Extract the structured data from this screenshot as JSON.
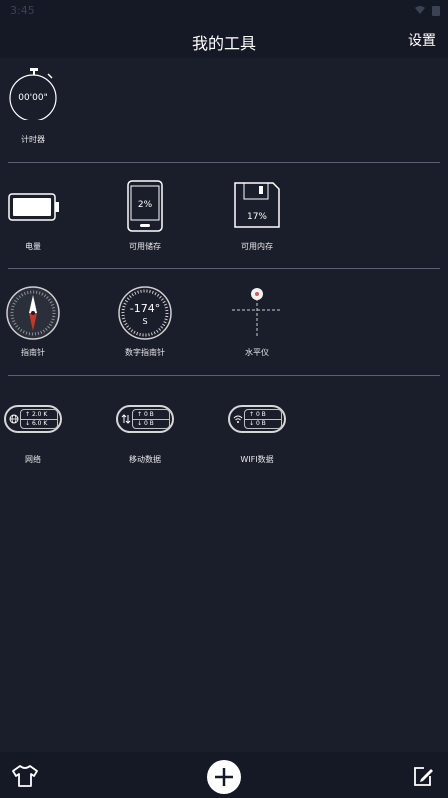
{
  "status": {
    "time": "3:45"
  },
  "header": {
    "title": "我的工具",
    "settings_label": "设置"
  },
  "sections": {
    "timer": {
      "value": "00'00\"",
      "label": "计时器"
    },
    "battery": {
      "label": "电量"
    },
    "storage": {
      "value": "2%",
      "label": "可用储存"
    },
    "memory": {
      "value": "17%",
      "label": "可用内存"
    },
    "compass": {
      "label": "指南针"
    },
    "digital_compass": {
      "value": "-174°",
      "direction": "S",
      "label": "数字指南针"
    },
    "level": {
      "label": "水平仪"
    },
    "network": {
      "up": "2.0 K",
      "down": "6.0 K",
      "label": "网络"
    },
    "mobile_data": {
      "up": "0 B",
      "down": "0 B",
      "label": "移动数据"
    },
    "wifi_data": {
      "up": "0 B",
      "down": "0 B",
      "label": "WIFI数据"
    }
  },
  "icons": {
    "shirt": "shirt-icon",
    "add": "add-icon",
    "edit": "edit-icon"
  },
  "colors": {
    "background": "#1a1e2b",
    "bar": "#151925",
    "compass_needle": "#c0392b"
  }
}
